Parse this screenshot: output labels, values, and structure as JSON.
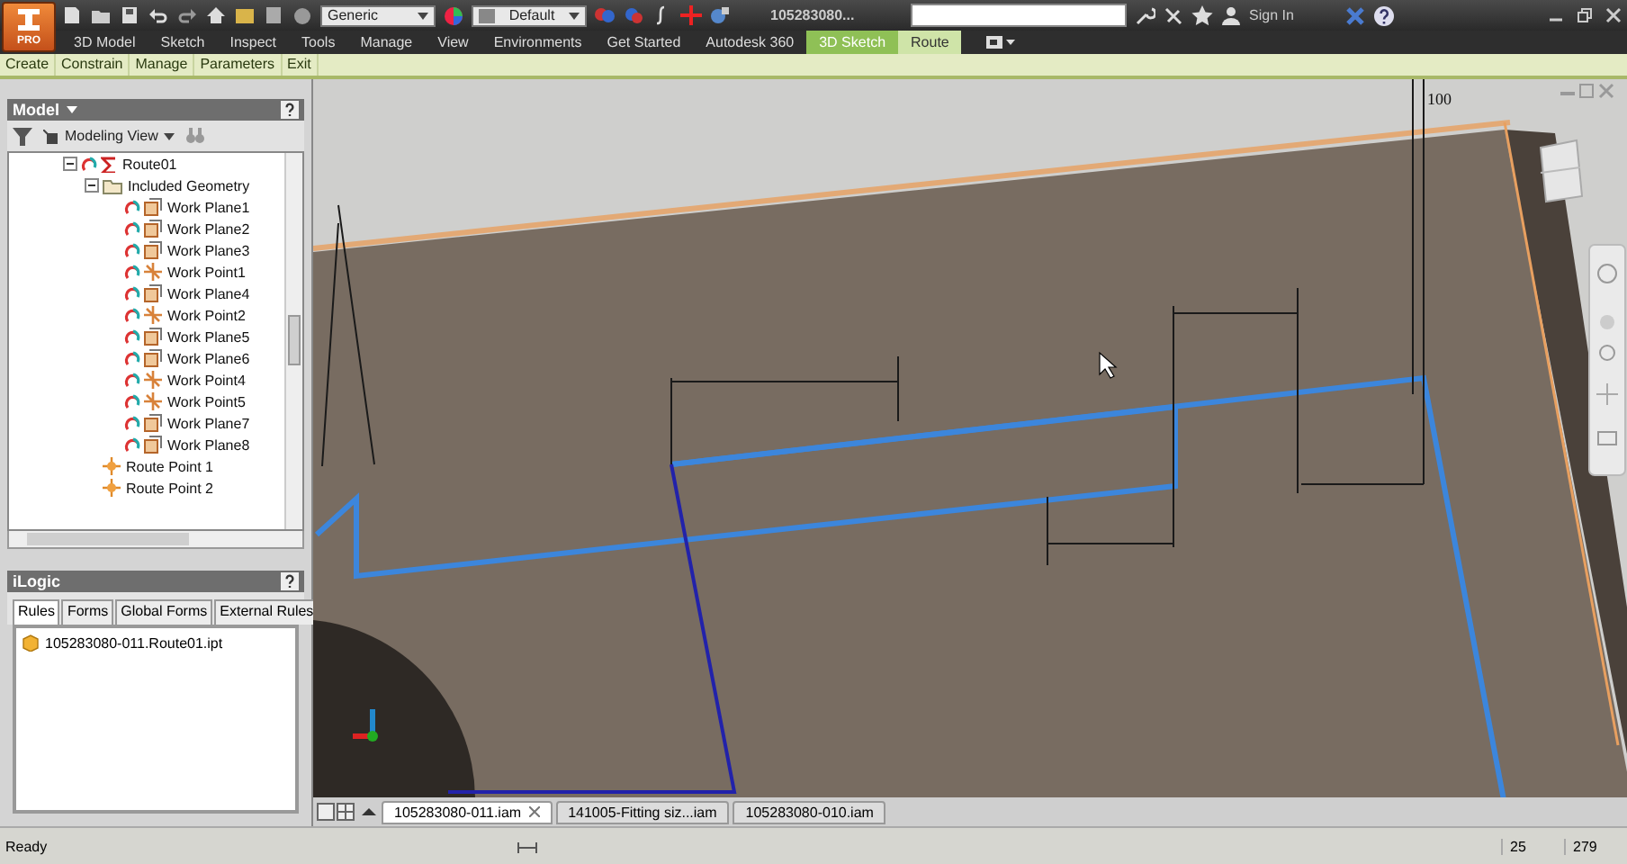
{
  "app_button": {
    "badge": "PRO"
  },
  "quick_access": {
    "material": "Generic",
    "appearance": "Default"
  },
  "title_bar": {
    "title": "105283080...",
    "sign_in": "Sign In"
  },
  "ribbon_tabs": [
    {
      "label": "3D Model",
      "selected": false,
      "contextual": false
    },
    {
      "label": "Sketch",
      "selected": false,
      "contextual": false
    },
    {
      "label": "Inspect",
      "selected": false,
      "contextual": false
    },
    {
      "label": "Tools",
      "selected": false,
      "contextual": false
    },
    {
      "label": "Manage",
      "selected": false,
      "contextual": false
    },
    {
      "label": "View",
      "selected": false,
      "contextual": false
    },
    {
      "label": "Environments",
      "selected": false,
      "contextual": false
    },
    {
      "label": "Get Started",
      "selected": false,
      "contextual": false
    },
    {
      "label": "Autodesk 360",
      "selected": false,
      "contextual": false
    },
    {
      "label": "3D Sketch",
      "selected": true,
      "contextual": true
    },
    {
      "label": "Route",
      "selected": false,
      "contextual": true
    }
  ],
  "ribbon_panels": [
    "Create",
    "Constrain",
    "Manage",
    "Parameters",
    "Exit"
  ],
  "model_browser": {
    "title": "Model",
    "view": "Modeling View",
    "tree": [
      {
        "label": "Route01",
        "kind": "route",
        "expanded": true,
        "children": [
          {
            "label": "Included Geometry",
            "kind": "folder",
            "expanded": true,
            "children": [
              {
                "label": "Work Plane1",
                "kind": "plane"
              },
              {
                "label": "Work Plane2",
                "kind": "plane"
              },
              {
                "label": "Work Plane3",
                "kind": "plane"
              },
              {
                "label": "Work Point1",
                "kind": "point"
              },
              {
                "label": "Work Plane4",
                "kind": "plane"
              },
              {
                "label": "Work Point2",
                "kind": "point"
              },
              {
                "label": "Work Plane5",
                "kind": "plane"
              },
              {
                "label": "Work Plane6",
                "kind": "plane"
              },
              {
                "label": "Work Point4",
                "kind": "point"
              },
              {
                "label": "Work Point5",
                "kind": "point"
              },
              {
                "label": "Work Plane7",
                "kind": "plane"
              },
              {
                "label": "Work Plane8",
                "kind": "plane"
              }
            ]
          },
          {
            "label": "Route Point 1",
            "kind": "routepoint"
          },
          {
            "label": "Route Point 2",
            "kind": "routepoint"
          }
        ]
      }
    ]
  },
  "ilogic": {
    "title": "iLogic",
    "tabs": [
      {
        "label": "Rules",
        "selected": true
      },
      {
        "label": "Forms",
        "selected": false
      },
      {
        "label": "Global Forms",
        "selected": false
      },
      {
        "label": "External Rules",
        "selected": false
      }
    ],
    "rules": [
      "105283080-011.Route01.ipt"
    ]
  },
  "viewport": {
    "dimension": "100"
  },
  "document_tabs": [
    {
      "label": "105283080-011.iam",
      "selected": true
    },
    {
      "label": "141005-Fitting siz...iam",
      "selected": false
    },
    {
      "label": "105283080-010.iam",
      "selected": false
    }
  ],
  "status_bar": {
    "message": "Ready",
    "fields": [
      "25",
      "279"
    ]
  }
}
